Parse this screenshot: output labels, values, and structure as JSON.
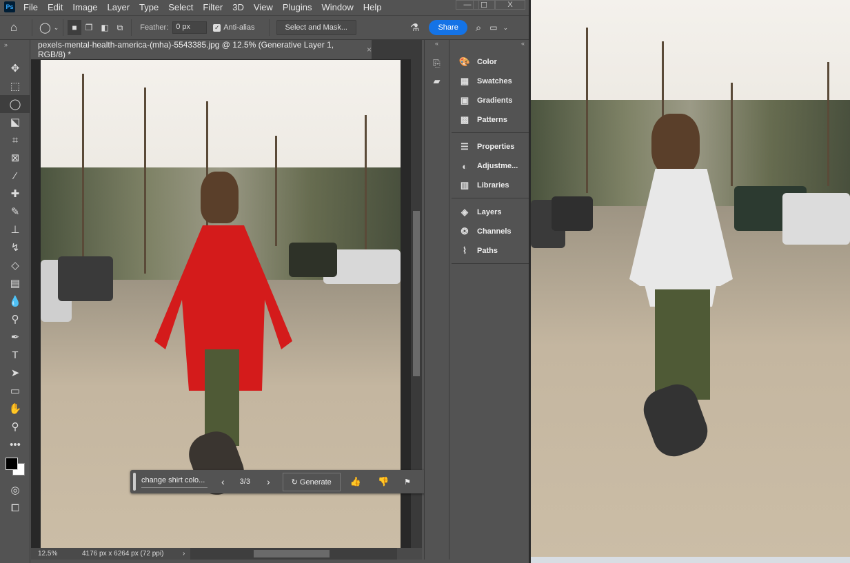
{
  "app": {
    "logo": "Ps",
    "menu": [
      "File",
      "Edit",
      "Image",
      "Layer",
      "Type",
      "Select",
      "Filter",
      "3D",
      "View",
      "Plugins",
      "Window",
      "Help"
    ]
  },
  "window_controls": {
    "minimize": "—",
    "maximize": "☐",
    "close": "X"
  },
  "options": {
    "feather_label": "Feather:",
    "feather_value": "0 px",
    "antialias_label": "Anti-alias",
    "antialias_checked": true,
    "select_mask": "Select and Mask...",
    "share": "Share"
  },
  "document": {
    "tab_title": "pexels-mental-health-america-(mha)-5543385.jpg @ 12.5% (Generative Layer 1, RGB/8) *",
    "zoom": "12.5%",
    "dimensions": "4176 px x 6264 px (72 ppi)"
  },
  "tools": [
    "move",
    "marquee",
    "lasso",
    "object-select",
    "crop",
    "frame",
    "eyedropper",
    "healing",
    "brush",
    "stamp",
    "history-brush",
    "eraser",
    "gradient",
    "blur",
    "dodge",
    "pen",
    "type",
    "path-select",
    "rectangle",
    "hand",
    "zoom",
    "more"
  ],
  "panels": {
    "groups": [
      [
        "Color",
        "Swatches",
        "Gradients",
        "Patterns"
      ],
      [
        "Properties",
        "Adjustme...",
        "Libraries"
      ],
      [
        "Layers",
        "Channels",
        "Paths"
      ]
    ]
  },
  "generative": {
    "prompt": "change shirt colo...",
    "counter": "3/3",
    "generate": "Generate"
  },
  "colors": {
    "accent": "#1473e6",
    "shirt": "#d41b1b",
    "hoodie": "#e8e8e8"
  }
}
